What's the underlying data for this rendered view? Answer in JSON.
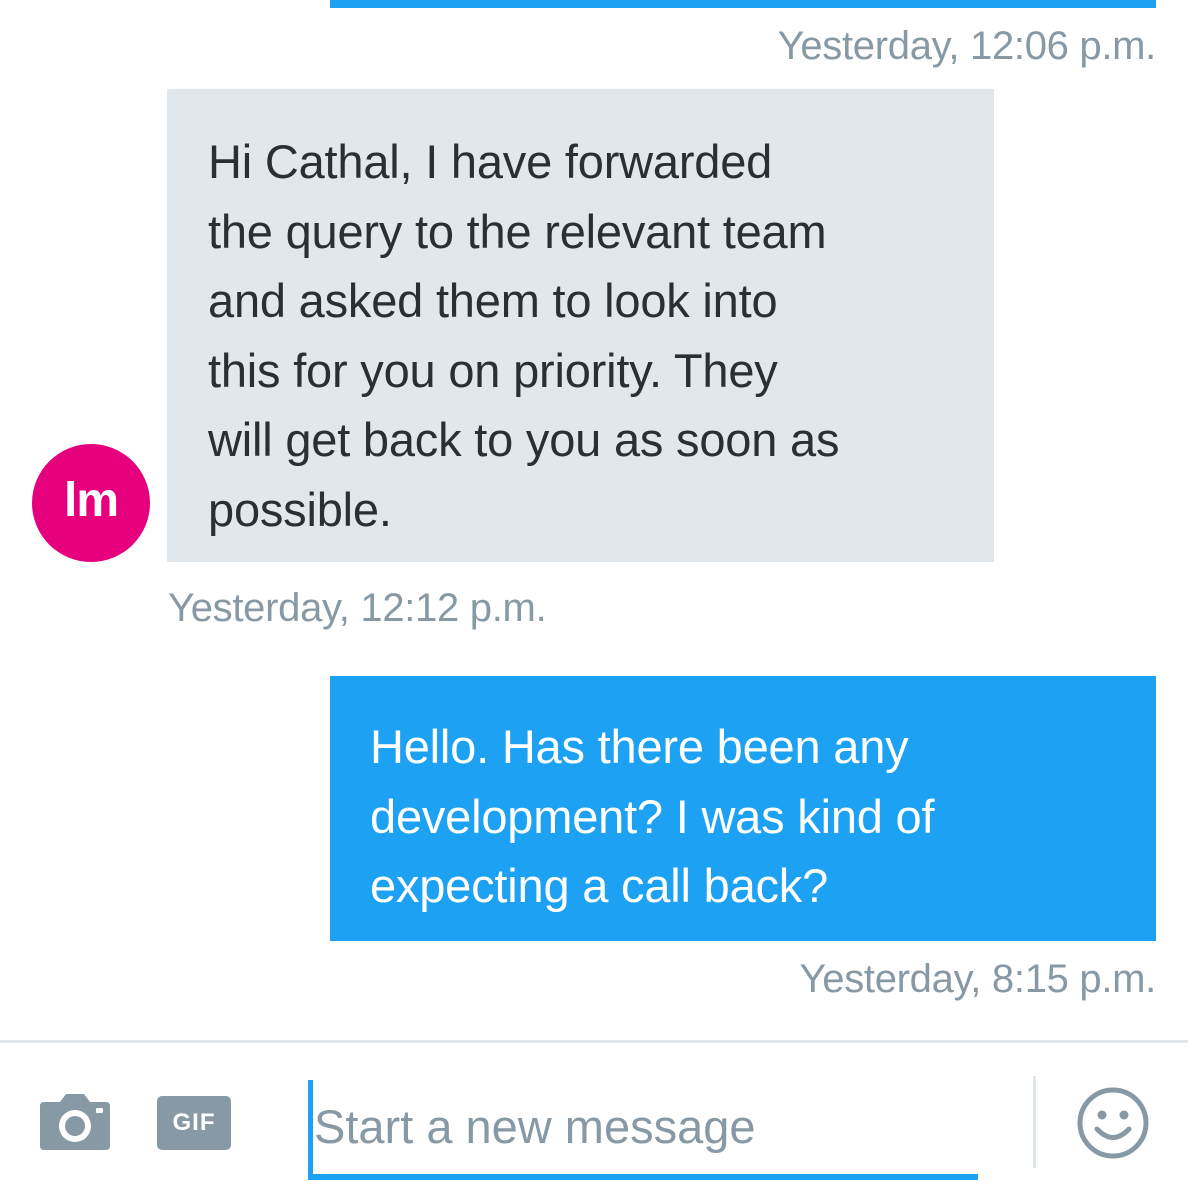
{
  "conversation": {
    "messages": [
      {
        "direction": "incoming",
        "text": "Hi Cathal, I have forwarded the query to the relevant team and asked them to look into this for you on priority. They will get back to you as soon as possible.",
        "lines": [
          "Hi Cathal, I have forwarded",
          "the query to the relevant team",
          "and asked them to look into",
          "this for you on priority. They",
          "will get back to you as soon as",
          "possible."
        ],
        "avatar_initials": "lm",
        "timestamp": "Yesterday, 12:12 p.m."
      },
      {
        "direction": "outgoing",
        "text": "Hello. Has there been any development? I was kind of expecting a call back?",
        "lines": [
          "Hello. Has there been any",
          "development? I was kind of",
          "expecting a call back?"
        ],
        "timestamp": "Yesterday, 8:15 p.m."
      }
    ],
    "previous_timestamp": "Yesterday, 12:06 p.m."
  },
  "composer": {
    "placeholder": "Start a new message",
    "gif_label": "GIF",
    "icons": {
      "camera": "camera-icon",
      "emoji": "smiley-icon"
    }
  },
  "colors": {
    "accent": "#1da1f2",
    "incoming_bubble": "#e1e8ed",
    "avatar": "#e6007e",
    "timestamp": "#8899a6",
    "icon_gray": "#8899a6"
  }
}
